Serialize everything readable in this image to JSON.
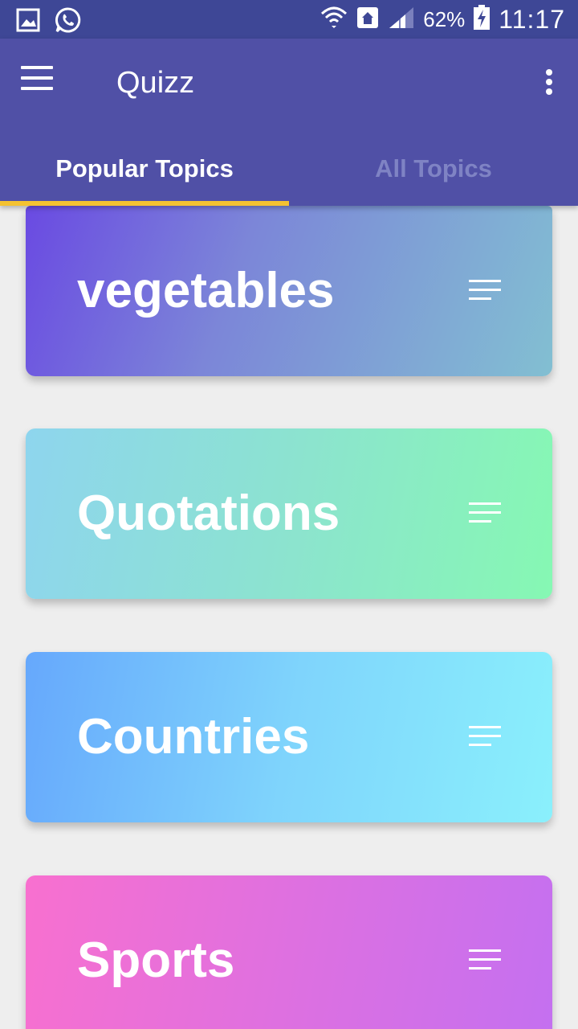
{
  "status_bar": {
    "left_icons": [
      "gallery-icon",
      "whatsapp-icon"
    ],
    "right_icons": [
      "wifi-icon",
      "home-icon",
      "signal-icon",
      "battery-charging-icon"
    ],
    "battery": "62%",
    "time": "11:17"
  },
  "app_bar": {
    "title": "Quizz",
    "menu_icon": "hamburger-menu-icon",
    "overflow_icon": "more-vert-icon"
  },
  "tabs": [
    {
      "label": "Popular Topics",
      "selected": true
    },
    {
      "label": "All Topics",
      "selected": false
    }
  ],
  "topics": [
    {
      "label": "vegetables",
      "icon": "sort-lines-icon"
    },
    {
      "label": "Quotations",
      "icon": "sort-lines-icon"
    },
    {
      "label": "Countries",
      "icon": "sort-lines-icon"
    },
    {
      "label": "Sports",
      "icon": "sort-lines-icon"
    }
  ],
  "colors": {
    "status_bar": "#3e4796",
    "app_bar": "#5050a6",
    "tab_indicator": "#f4c232",
    "background": "#eeeeee"
  }
}
